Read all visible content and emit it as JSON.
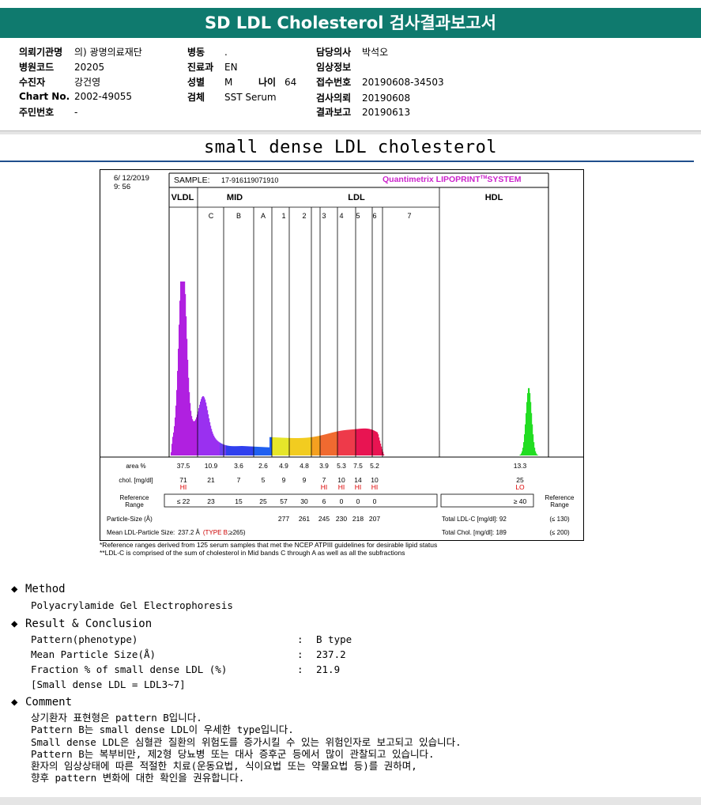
{
  "report_title": "SD LDL Cholesterol 검사결과보고서",
  "info": {
    "institution_label": "의뢰기관명",
    "institution": "의) 광명의료재단",
    "hospital_code_label": "병원코드",
    "hospital_code": "20205",
    "patient_label": "수진자",
    "patient": "강건영",
    "chart_label": "Chart No.",
    "chart_no": "2002-49055",
    "resident_label": "주민번호",
    "resident_no": "-",
    "ward_label": "병동",
    "ward": ".",
    "dept_label": "진료과",
    "dept": "EN",
    "sex_label": "성별",
    "sex": "M",
    "age_label": "나이",
    "age": "64",
    "specimen_label": "검체",
    "specimen": "SST Serum",
    "doctor_label": "담당의사",
    "doctor": "박석오",
    "clinical_label": "임상정보",
    "clinical": "",
    "receipt_label": "접수번호",
    "receipt_no": "20190608-34503",
    "request_label": "검사의뢰",
    "request_date": "20190608",
    "report_label": "결과보고",
    "report_date": "20190613"
  },
  "section_title": "small dense LDL cholesterol",
  "chart_data": {
    "type": "area",
    "date": "6/ 12/2019",
    "time": "9: 56",
    "sample_label": "SAMPLE:",
    "sample_id": "17-916119071910",
    "system_name": "Quantimetrix LIPOPRINT",
    "system_tm": "TM",
    "system_suffix": "SYSTEM",
    "band_groups": [
      "VLDL",
      "MID",
      "LDL",
      "HDL"
    ],
    "band_labels": [
      "C",
      "B",
      "A",
      "1",
      "2",
      "3",
      "4",
      "5",
      "6",
      "7"
    ],
    "row_labels": {
      "area": "area %",
      "chol": "chol. [mg/dl]",
      "ref_line1": "Reference",
      "ref_line2": "Range",
      "particle": "Particle-Size (Å)",
      "mean_label": "Mean LDL-Particle Size:",
      "mean_value": "237.2 Å",
      "type_text": "(TYPE B",
      "type_tail": ";≥265)",
      "ref_right1": "Reference",
      "ref_right2": "Range"
    },
    "area": [
      "37.5",
      "10.9",
      "3.6",
      "2.6",
      "4.9",
      "4.8",
      "3.9",
      "5.3",
      "7.5",
      "5.2",
      "",
      "13.3"
    ],
    "chol": [
      "71",
      "21",
      "7",
      "5",
      "9",
      "9",
      "7",
      "10",
      "14",
      "10",
      "",
      "25"
    ],
    "flags": [
      "HI",
      "",
      "",
      "",
      "",
      "",
      "HI",
      "HI",
      "HI",
      "HI",
      "",
      "LO"
    ],
    "reference": [
      "≤ 22",
      "23",
      "15",
      "25",
      "57",
      "30",
      "6",
      "0",
      "0",
      "0",
      "",
      "≥ 40"
    ],
    "particle_size": [
      "277",
      "261",
      "245",
      "230",
      "218",
      "207"
    ],
    "total_ldl": "Total LDL-C [mg/dl]: 92",
    "total_ldl_ref": "(≤ 130)",
    "total_chol": "Total Chol. [mg/dl]:  189",
    "total_chol_ref": "(≤ 200)"
  },
  "notes": [
    "*Reference ranges derived from 125 serum samples that met the NCEP ATPIII guidelines for desirable lipid status",
    "**LDL-C is comprised of the sum of cholesterol in Mid bands C through A as well as all the subfractions"
  ],
  "method": {
    "title": "Method",
    "text": "Polyacrylamide Gel Electrophoresis"
  },
  "result": {
    "title": "Result & Conclusion",
    "rows": [
      {
        "label": "Pattern(phenotype)",
        "colon": ":",
        "value": "B type"
      },
      {
        "label": "Mean Particle Size(Å)",
        "colon": ":",
        "value": "237.2"
      },
      {
        "label": "Fraction % of small dense LDL (%)",
        "colon": ":",
        "value": "21.9"
      }
    ],
    "note": "[Small dense LDL = LDL3~7]"
  },
  "comment": {
    "title": "Comment",
    "lines": [
      "상기환자 표현형은 pattern B입니다.",
      "Pattern B는 small dense LDL이 우세한 type입니다.",
      "Small dense LDL은 심혈관 질환의 위험도를 증가시킬 수 있는 위험인자로 보고되고 있습니다.",
      "Pattern B는 복부비만, 제2형 당뇨병 또는 대사 증후군 등에서 많이 관찰되고 있습니다.",
      "환자의 임상상태에 따른 적절한 치료(운동요법, 식이요법 또는 약물요법 등)를 권하며,",
      "향후 pattern 변화에 대한 확인을 권유합니다."
    ]
  }
}
